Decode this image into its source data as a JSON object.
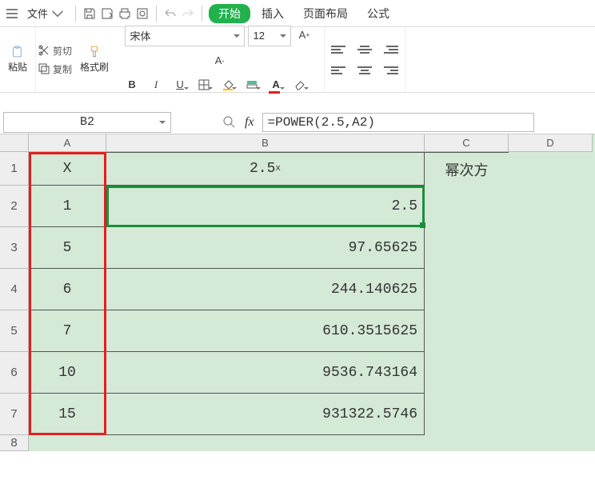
{
  "menu": {
    "file": "文件"
  },
  "tabs": {
    "start": "开始",
    "insert": "插入",
    "layout": "页面布局",
    "formula": "公式"
  },
  "clipboard": {
    "paste": "粘贴",
    "cut": "剪切",
    "copy": "复制",
    "brush": "格式刷"
  },
  "font": {
    "name": "宋体",
    "size": "12",
    "bold": "B",
    "italic": "I",
    "underline": "U"
  },
  "namebox": "B2",
  "formula": "=POWER(2.5,A2)",
  "headers": {
    "a": "A",
    "b": "B",
    "c": "C",
    "d": "D"
  },
  "rows": [
    "1",
    "2",
    "3",
    "4",
    "5",
    "6",
    "7",
    "8"
  ],
  "table": {
    "h_a": "X",
    "h_b_base": "2.5",
    "h_b_exp": "x",
    "h_c": "幂次方",
    "r": [
      {
        "a": "1",
        "b": "2.5"
      },
      {
        "a": "5",
        "b": "97.65625"
      },
      {
        "a": "6",
        "b": "244.140625"
      },
      {
        "a": "7",
        "b": "610.3515625"
      },
      {
        "a": "10",
        "b": "9536.743164"
      },
      {
        "a": "15",
        "b": "931322.5746"
      }
    ]
  }
}
